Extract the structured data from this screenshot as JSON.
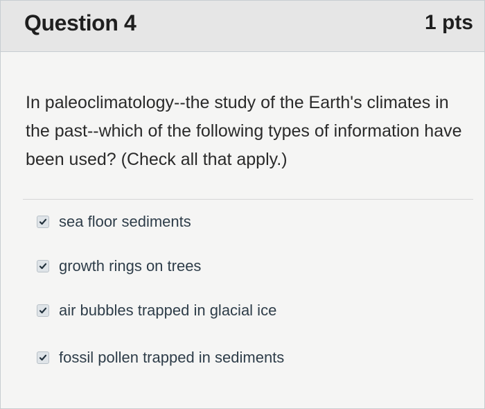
{
  "question": {
    "title": "Question 4",
    "points": "1 pts",
    "text": "In paleoclimatology--the study of the Earth's climates in the past--which of the following types of information have been used? (Check all that apply.)",
    "answers": [
      {
        "label": "sea floor sediments",
        "checked": true
      },
      {
        "label": "growth rings on trees",
        "checked": true
      },
      {
        "label": "air bubbles trapped in glacial ice",
        "checked": true
      },
      {
        "label": "fossil pollen trapped in sediments",
        "checked": true
      }
    ]
  },
  "icons": {
    "checkbox": "checkmark-icon"
  },
  "colors": {
    "header_background": "#e6e6e6",
    "body_background": "#f5f5f4",
    "text": "#2d3b45",
    "checkbox_fill": "#dfe4e8",
    "checkmark": "#22313c"
  }
}
